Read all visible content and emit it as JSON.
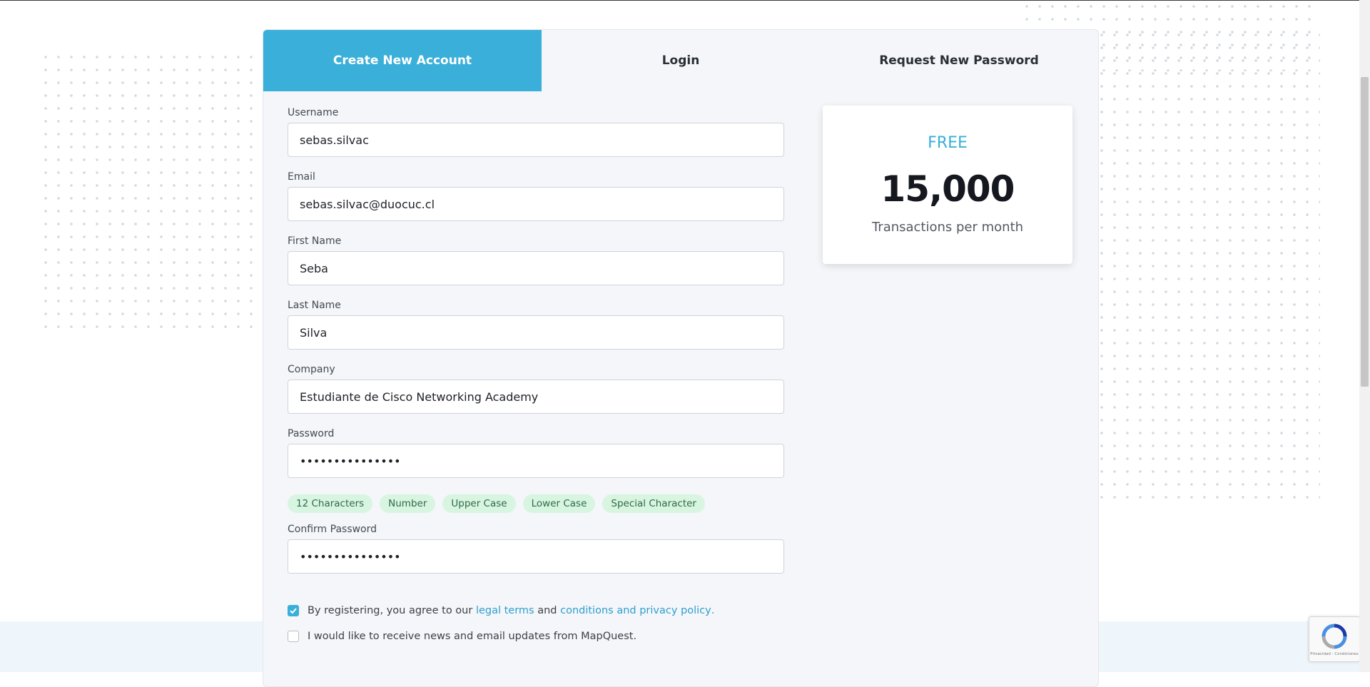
{
  "tabs": [
    {
      "label": "Create New Account",
      "active": true
    },
    {
      "label": "Login",
      "active": false
    },
    {
      "label": "Request New Password",
      "active": false
    }
  ],
  "form": {
    "username": {
      "label": "Username",
      "value": "sebas.silvac"
    },
    "email": {
      "label": "Email",
      "value": "sebas.silvac@duocuc.cl"
    },
    "first_name": {
      "label": "First Name",
      "value": "Seba"
    },
    "last_name": {
      "label": "Last Name",
      "value": "Silva"
    },
    "company": {
      "label": "Company",
      "value": "Estudiante de Cisco Networking Academy"
    },
    "password": {
      "label": "Password",
      "value": "•••••••••••••••"
    },
    "password_rules": [
      "12 Characters",
      "Number",
      "Upper Case",
      "Lower Case",
      "Special Character"
    ],
    "confirm_password": {
      "label": "Confirm Password",
      "value": "•••••••••••••••"
    },
    "terms": {
      "checked": true,
      "text_before": "By registering, you agree to our",
      "link1": "legal terms",
      "text_between": "and",
      "link2": "conditions and privacy policy",
      "text_after": "."
    },
    "newsletter": {
      "checked": false,
      "text": "I would like to receive news and email updates from MapQuest."
    }
  },
  "plan": {
    "name": "FREE",
    "amount": "15,000",
    "unit": "Transactions per month"
  },
  "recaptcha": {
    "footer": "Privacidad - Condiciones"
  },
  "colors": {
    "accent": "#3aafd9",
    "chip_bg": "#d8f5e2",
    "chip_text": "#2f6a45",
    "card_bg": "#f4f6f9"
  }
}
